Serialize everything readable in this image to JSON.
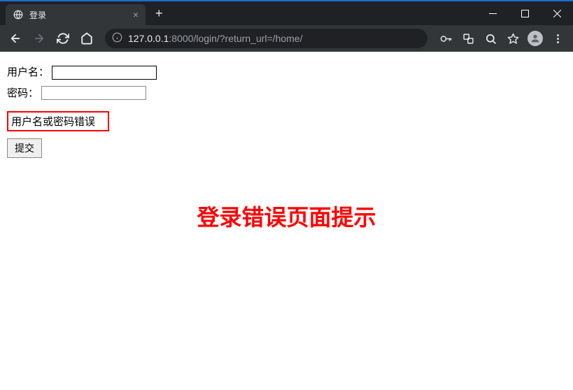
{
  "browser": {
    "tab_title": "登录",
    "url_host": "127.0.0.1",
    "url_port": ":8000",
    "url_path": "/login/?return_url=/home/"
  },
  "form": {
    "username_label": "用户名：",
    "password_label": "密码：",
    "username_value": "",
    "password_value": "",
    "error_message": "用户名或密码错误",
    "submit_label": "提交"
  },
  "annotation": {
    "text": "登录错误页面提示"
  },
  "colors": {
    "error_red": "#ff0000",
    "browser_dark": "#202124",
    "toolbar_dark": "#323639"
  }
}
